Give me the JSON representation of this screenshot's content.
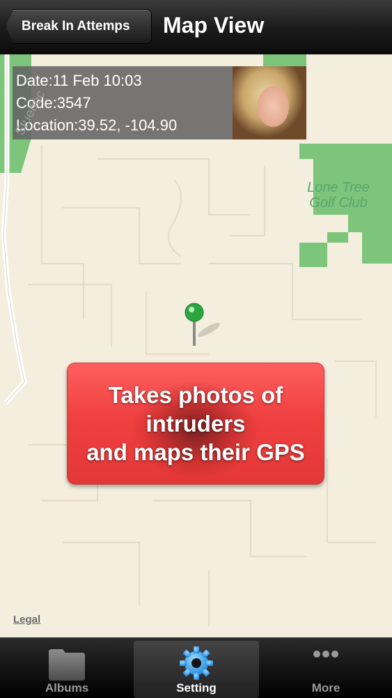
{
  "navbar": {
    "back_label": "Break In Attemps",
    "title": "Map View"
  },
  "info": {
    "date": "Date:11 Feb 10:03",
    "code": "Code:3547",
    "location": "Location:39.52, -104.90"
  },
  "map": {
    "golf_label": "Lone Tree\nGolf Club",
    "street_label": "Stuebec",
    "legal": "Legal",
    "promo": "Takes photos of\nintruders\nand maps their GPS"
  },
  "tabbar": {
    "tabs": [
      {
        "label": "Albums",
        "icon": "albums-icon"
      },
      {
        "label": "Setting",
        "icon": "gear-icon",
        "selected": true
      },
      {
        "label": "More",
        "icon": "more-icon"
      }
    ]
  },
  "colors": {
    "map_bg": "#f3eedd",
    "park_green": "#7dc57b",
    "pin_green": "#2ea640",
    "promo_red": "#f04040"
  }
}
